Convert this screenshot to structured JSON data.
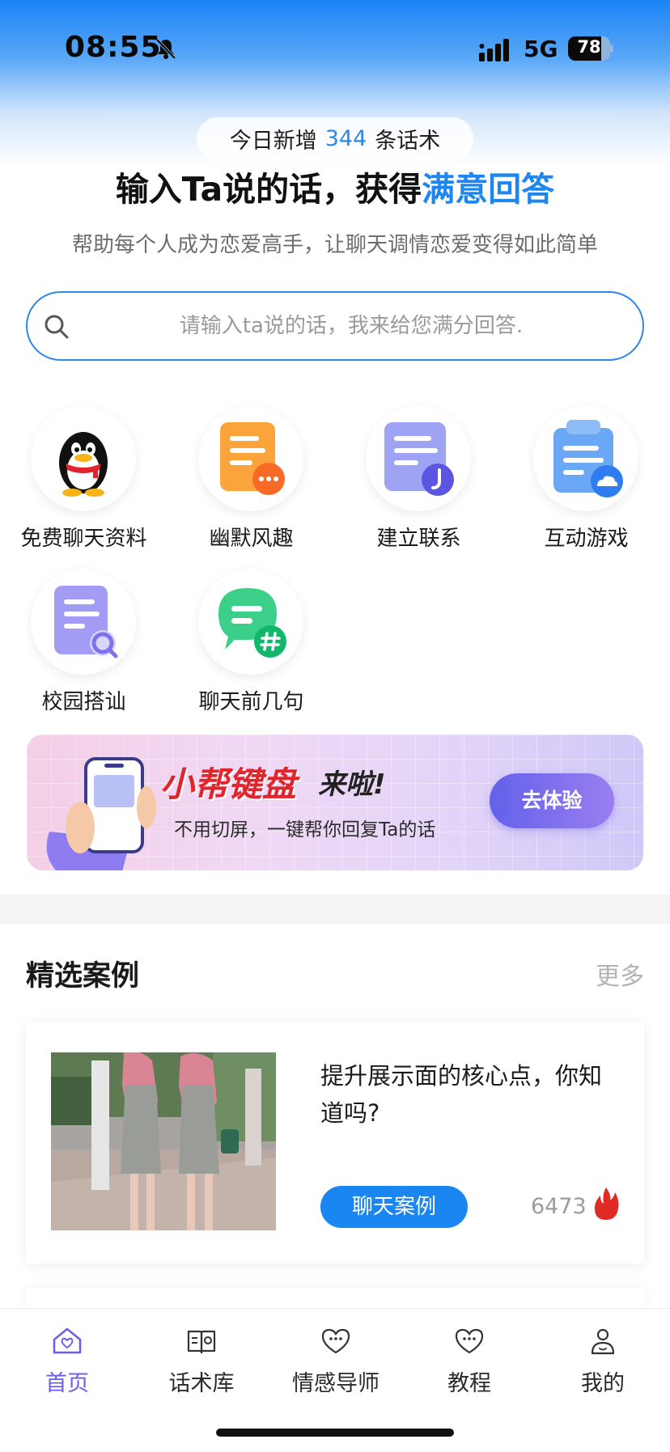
{
  "status_bar": {
    "time": "08:55",
    "network": "5G",
    "battery": "78",
    "battery_level": 0.78,
    "icons": [
      "mute-bell-icon",
      "signal-icon",
      "battery-icon"
    ]
  },
  "hero": {
    "daily_prefix": "今日新增",
    "daily_count": "344",
    "daily_suffix": "条话术",
    "headline_main": "输入Ta说的话，获得",
    "headline_accent": "满意回答",
    "subline": "帮助每个人成为恋爱高手，让聊天调情恋爱变得如此简单",
    "accent_color": "#1e86f0"
  },
  "search": {
    "placeholder": "请输入ta说的话，我来给您满分回答.",
    "value": ""
  },
  "features": [
    {
      "label": "免费聊天资料",
      "icon": "qq-penguin-icon"
    },
    {
      "label": "幽默风趣",
      "icon": "orange-document-chat-icon"
    },
    {
      "label": "建立联系",
      "icon": "purple-document-clock-icon"
    },
    {
      "label": "互动游戏",
      "icon": "blue-clipboard-cloud-icon"
    },
    {
      "label": "校园搭讪",
      "icon": "purple-document-search-icon"
    },
    {
      "label": "聊天前几句",
      "icon": "green-chat-hashtag-icon"
    }
  ],
  "banner": {
    "title_red": "小帮键盘",
    "title_rest": "来啦!",
    "subtitle": "不用切屏，一键帮你回复Ta的话",
    "button": "去体验"
  },
  "section": {
    "title": "精选案例",
    "more": "更多"
  },
  "cases": [
    {
      "title": "提升展示面的核心点，你知道吗?",
      "tag": "聊天案例",
      "views": "6473",
      "icon": "fire-icon"
    }
  ],
  "tabs": [
    {
      "label": "首页",
      "icon": "home-heart-icon",
      "active": true
    },
    {
      "label": "话术库",
      "icon": "book-icon",
      "active": false
    },
    {
      "label": "情感导师",
      "icon": "heart-chat-icon",
      "active": false
    },
    {
      "label": "教程",
      "icon": "heart-chat-icon",
      "active": false
    },
    {
      "label": "我的",
      "icon": "user-icon",
      "active": false
    }
  ],
  "colors": {
    "primary": "#1a86f2",
    "tab_active": "#6a5ee8",
    "banner_button": "#6461ea",
    "banner_title": "#e0252d"
  }
}
